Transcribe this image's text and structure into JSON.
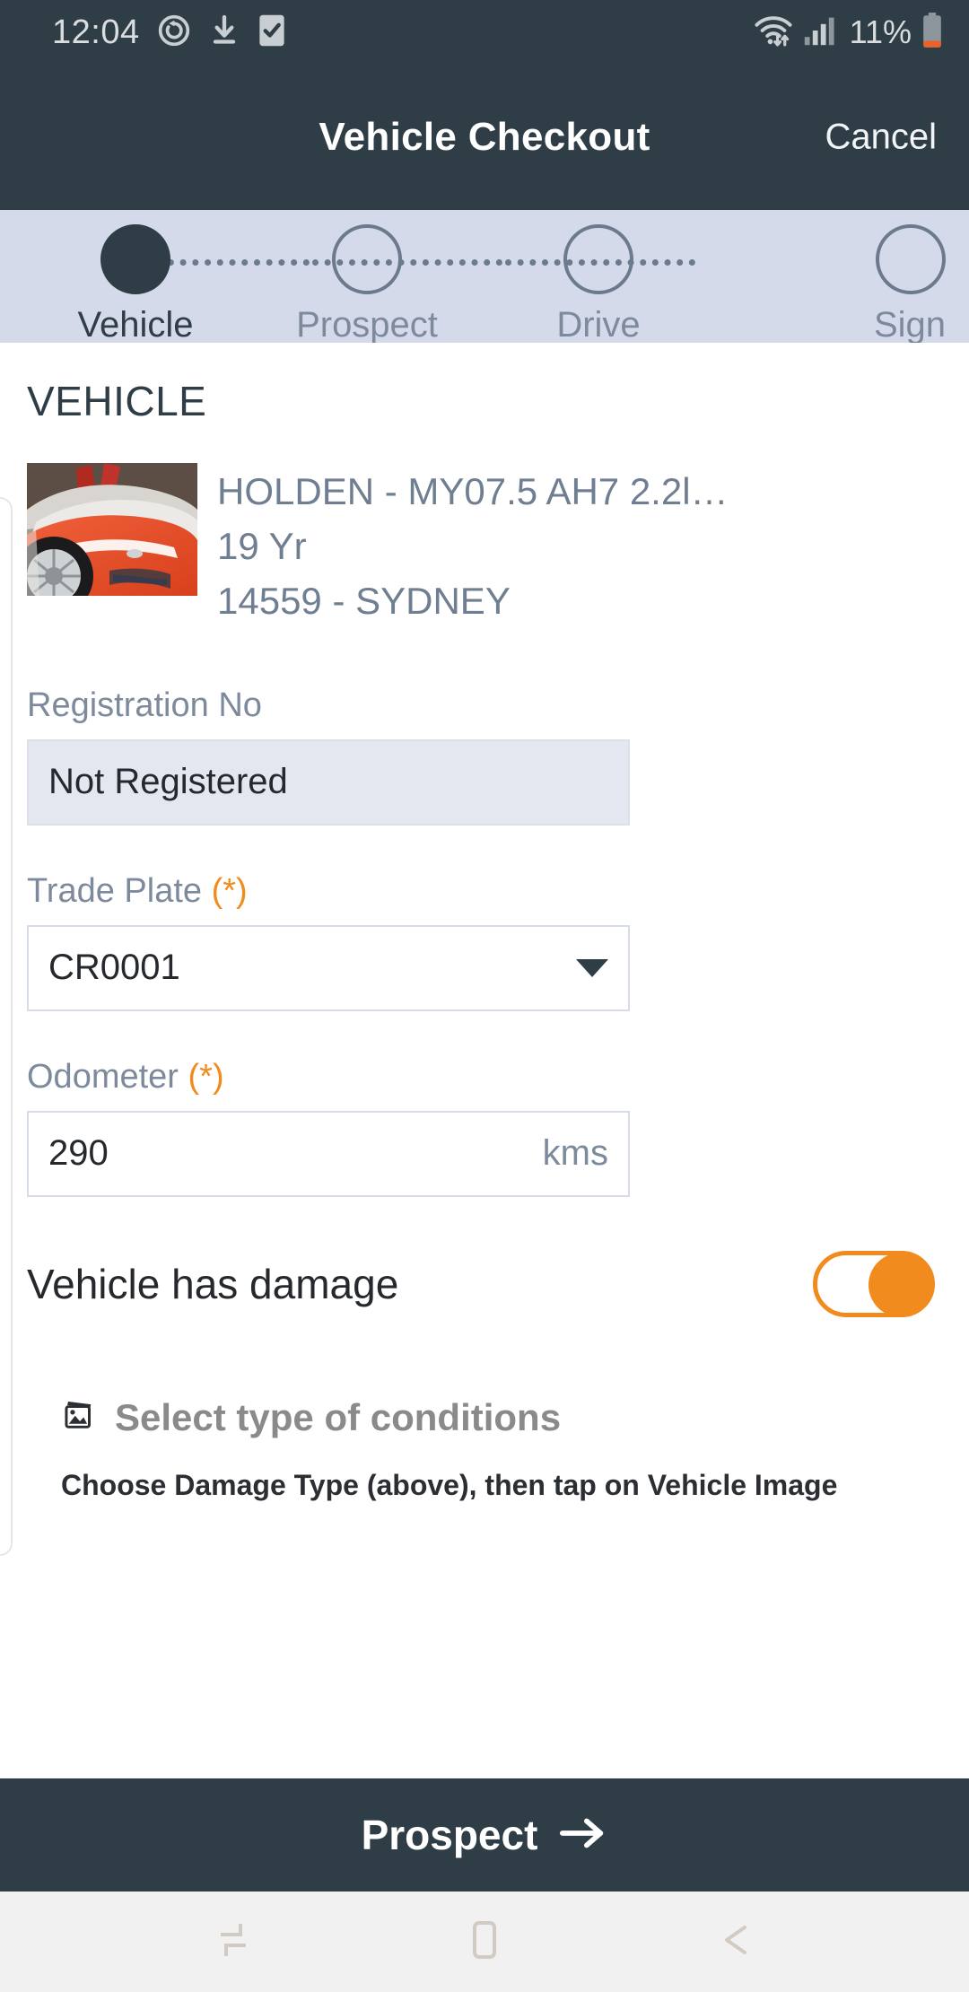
{
  "status_bar": {
    "time": "12:04",
    "battery_percent": "11%",
    "icons": [
      "sync-icon",
      "download-icon",
      "checkbox-checked-icon",
      "wifi-icon",
      "cellular-signal-icon",
      "battery-icon"
    ],
    "text_color": "#d9dde0",
    "background": "#2f3e46"
  },
  "app_bar": {
    "title": "Vehicle Checkout",
    "cancel_label": "Cancel",
    "background": "#2f3e46"
  },
  "stepper": {
    "background": "#d5daea",
    "active_index": 0,
    "steps": [
      {
        "label": "Vehicle",
        "state": "active"
      },
      {
        "label": "Prospect",
        "state": "pending"
      },
      {
        "label": "Drive",
        "state": "pending"
      },
      {
        "label": "Sign",
        "state": "pending"
      }
    ]
  },
  "vehicle_section": {
    "heading": "VEHICLE",
    "thumbnail_alt": "vehicle-photo",
    "description": "HOLDEN - MY07.5 AH7 2.2l…",
    "age": "19 Yr",
    "location": "14559 - SYDNEY"
  },
  "form": {
    "registration": {
      "label": "Registration No",
      "value": "Not Registered",
      "disabled": true
    },
    "trade_plate": {
      "label": "Trade Plate",
      "required_marker": "(*)",
      "value": "CR0001",
      "options": [
        "CR0001"
      ]
    },
    "odometer": {
      "label": "Odometer",
      "required_marker": "(*)",
      "value": "290",
      "unit": "kms"
    },
    "damage_toggle": {
      "label": "Vehicle has damage",
      "state": "on",
      "accent_color": "#f28b1e"
    }
  },
  "conditions": {
    "title": "Select type of conditions",
    "icon": "image-stack-icon",
    "hint": "Choose Damage Type (above), then tap on Vehicle Image"
  },
  "cta": {
    "label": "Prospect",
    "arrow": "arrow-right-icon",
    "background": "#2f3e46"
  },
  "nav_bar": {
    "items": [
      "recents-icon",
      "home-icon",
      "back-icon"
    ],
    "background": "#f1f1f1"
  }
}
